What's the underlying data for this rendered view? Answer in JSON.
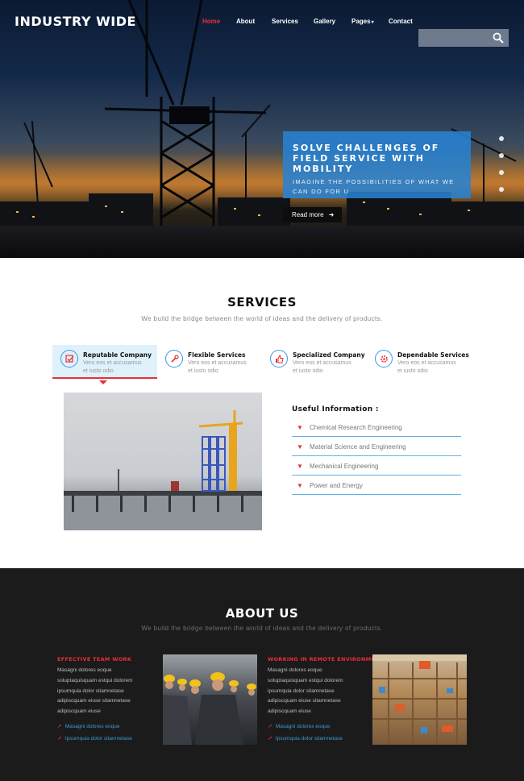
{
  "header": {
    "brand": "INDUSTRY WIDE",
    "nav": [
      "Home",
      "About",
      "Services",
      "Gallery",
      "Pages",
      "Contact"
    ],
    "active_nav": "Home",
    "search_placeholder": ""
  },
  "hero": {
    "title": "SOLVE CHALLENGES OF FIELD SERVICE WITH MOBILITY",
    "subtitle": "IMAGINE THE POSSIBILITIES OF WHAT WE CAN DO FOR U",
    "button": "Read more",
    "slide_count": 4
  },
  "services": {
    "title": "SERVICES",
    "subtitle": "We build the bridge between the world of ideas and the delivery of products.",
    "features": [
      {
        "title": "Reputable Company",
        "desc": "Vero eos et accusamus et iusto odio",
        "icon": "check-icon"
      },
      {
        "title": "Flexible Services",
        "desc": "Vero eos et accusamus et iusto odio",
        "icon": "wrench-icon"
      },
      {
        "title": "Specialized Company",
        "desc": "Vero eos et accusamus et iusto odio",
        "icon": "thumbs-up-icon"
      },
      {
        "title": "Dependable Services",
        "desc": "Vero eos et accusamus et iusto odio",
        "icon": "cog-icon"
      }
    ],
    "useful_title": "Useful Information :",
    "useful_items": [
      "Chemical Research Engineering",
      "Material Science and Engineering",
      "Mechanical Engineering",
      "Power and Energy"
    ]
  },
  "about": {
    "title": "ABOUT US",
    "subtitle": "We build the bridge between the world of ideas and the delivery of products.",
    "columns": [
      {
        "title": "EFFECTIVE TEAM WORK",
        "body": [
          "Masagni dolores eoque",
          "soluptaquisquam estqui dolorem",
          "ipsumquia dolor sitamnetase",
          "adipiscquam eiuse sitamnetase",
          "adipiscquam eiuse"
        ],
        "links": [
          "Masagni dolores eoque",
          "Ipsumquia dolor sitamnetase"
        ]
      },
      {
        "title": "WORKING IN REMOTE ENVIRONMENTS",
        "body": [
          "Masagni dolores eoque",
          "soluptaquisquam estqui dolorem",
          "ipsumquia dolor sitamnetase",
          "adipiscquam eiuse sitamnetase",
          "adipiscquam eiuse"
        ],
        "links": [
          "Masagni dolores eoque",
          "Ipsumquia dolor sitamnetase"
        ]
      }
    ]
  },
  "colors": {
    "accent_red": "#e8303a",
    "accent_blue": "#3a9ad9",
    "dark_bg": "#1b1b1b"
  }
}
